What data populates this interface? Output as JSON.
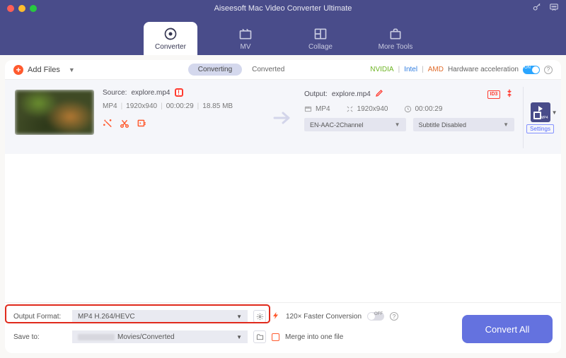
{
  "window": {
    "title": "Aiseesoft Mac Video Converter Ultimate"
  },
  "nav": {
    "converter": "Converter",
    "mv": "MV",
    "collage": "Collage",
    "moreTools": "More Tools"
  },
  "toolbar": {
    "addFiles": "Add Files",
    "converting": "Converting",
    "converted": "Converted",
    "nvidia": "NVIDIA",
    "intel": "Intel",
    "amd": "AMD",
    "hwAccel": "Hardware acceleration"
  },
  "file": {
    "sourceLabel": "Source:",
    "sourceName": "explore.mp4",
    "format": "MP4",
    "resolution": "1920x940",
    "duration": "00:00:29",
    "size": "18.85 MB",
    "outputLabel": "Output:",
    "outputName": "explore.mp4",
    "outFormat": "MP4",
    "outResolution": "1920x940",
    "outDuration": "00:00:29",
    "audio": "EN-AAC-2Channel",
    "subtitle": "Subtitle Disabled",
    "settings": "Settings"
  },
  "footer": {
    "outputFormatLabel": "Output Format:",
    "outputFormatValue": "MP4 H.264/HEVC",
    "saveToLabel": "Save to:",
    "saveToValue": "Movies/Converted",
    "faster": "120× Faster Conversion",
    "merge": "Merge into one file",
    "convertAll": "Convert All"
  }
}
